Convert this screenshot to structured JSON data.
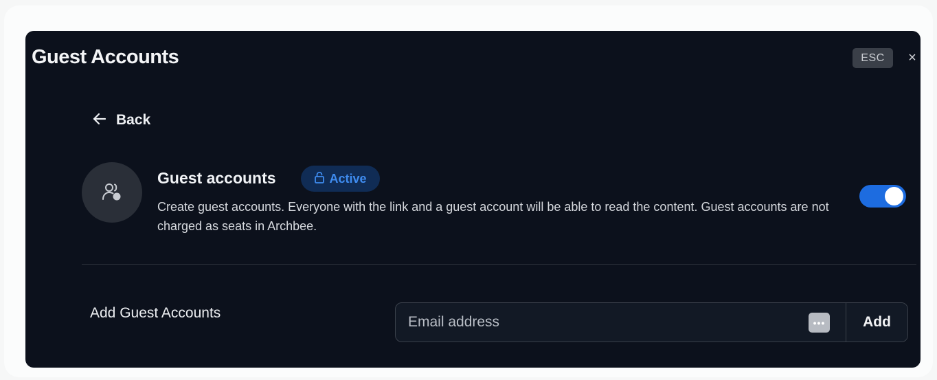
{
  "header": {
    "title": "Guest Accounts",
    "esc_label": "ESC",
    "close_glyph": "×"
  },
  "nav": {
    "back_label": "Back"
  },
  "feature": {
    "title": "Guest accounts",
    "badge_label": "Active",
    "description": "Create guest accounts. Everyone with the link and a guest account will be able to read the content. Guest accounts are not charged as seats in Archbee.",
    "enabled": true,
    "icon": "guest-users-icon"
  },
  "add_guest": {
    "section_label": "Add Guest Accounts",
    "email_placeholder": "Email address",
    "email_value": "",
    "dots_glyph": "•••",
    "add_label": "Add"
  },
  "colors": {
    "panel_bg": "#0c111c",
    "accent": "#1d6ce0",
    "badge_text": "#3f8cf0",
    "badge_bg": "#102c55"
  }
}
